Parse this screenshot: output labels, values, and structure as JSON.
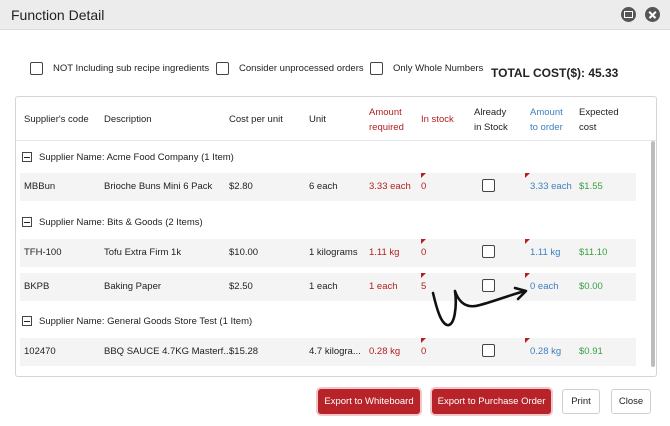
{
  "window": {
    "title": "Function Detail"
  },
  "options": {
    "sub_recipe": "NOT Including sub recipe ingredients",
    "unprocessed": "Consider unprocessed orders",
    "whole_numbers": "Only Whole Numbers"
  },
  "total_cost": "TOTAL COST($): 45.33",
  "columns": {
    "code": "Supplier's code",
    "desc": "Description",
    "cost": "Cost per unit",
    "unit": "Unit",
    "amount_required": [
      "Amount",
      "required"
    ],
    "in_stock": "In stock",
    "already": [
      "Already",
      "in Stock"
    ],
    "amount_order": [
      "Amount",
      "to order"
    ],
    "expected": [
      "Expected",
      "cost"
    ]
  },
  "groups": [
    {
      "label": "Supplier Name: Acme Food Company (1 Item)"
    },
    {
      "label": "Supplier Name: Bits & Goods (2 Items)"
    },
    {
      "label": "Supplier Name: General Goods Store Test (1 Item)"
    }
  ],
  "rows": [
    {
      "code": "MBBun",
      "desc": "Brioche Buns Mini 6 Pack",
      "cost": "$2.80",
      "unit": "6 each",
      "required": "3.33 each",
      "stock": "0",
      "order": "3.33 each",
      "expected": "$1.55"
    },
    {
      "code": "TFH-100",
      "desc": "Tofu Extra Firm 1k",
      "cost": "$10.00",
      "unit": "1 kilograms",
      "required": "1.11 kg",
      "stock": "0",
      "order": "1.11 kg",
      "expected": "$11.10"
    },
    {
      "code": "BKPB",
      "desc": "Baking Paper",
      "cost": "$2.50",
      "unit": "1 each",
      "required": "1 each",
      "stock": "5",
      "order": "0 each",
      "expected": "$0.00"
    },
    {
      "code": "102470",
      "desc": "BBQ SAUCE 4.7KG Masterf...",
      "cost": "$15.28",
      "unit": "4.7 kilogra...",
      "required": "0.28 kg",
      "stock": "0",
      "order": "0.28 kg",
      "expected": "$0.91"
    }
  ],
  "buttons": {
    "export_whiteboard": "Export to Whiteboard",
    "export_po": "Export to Purchase Order",
    "print": "Print",
    "close": "Close"
  }
}
